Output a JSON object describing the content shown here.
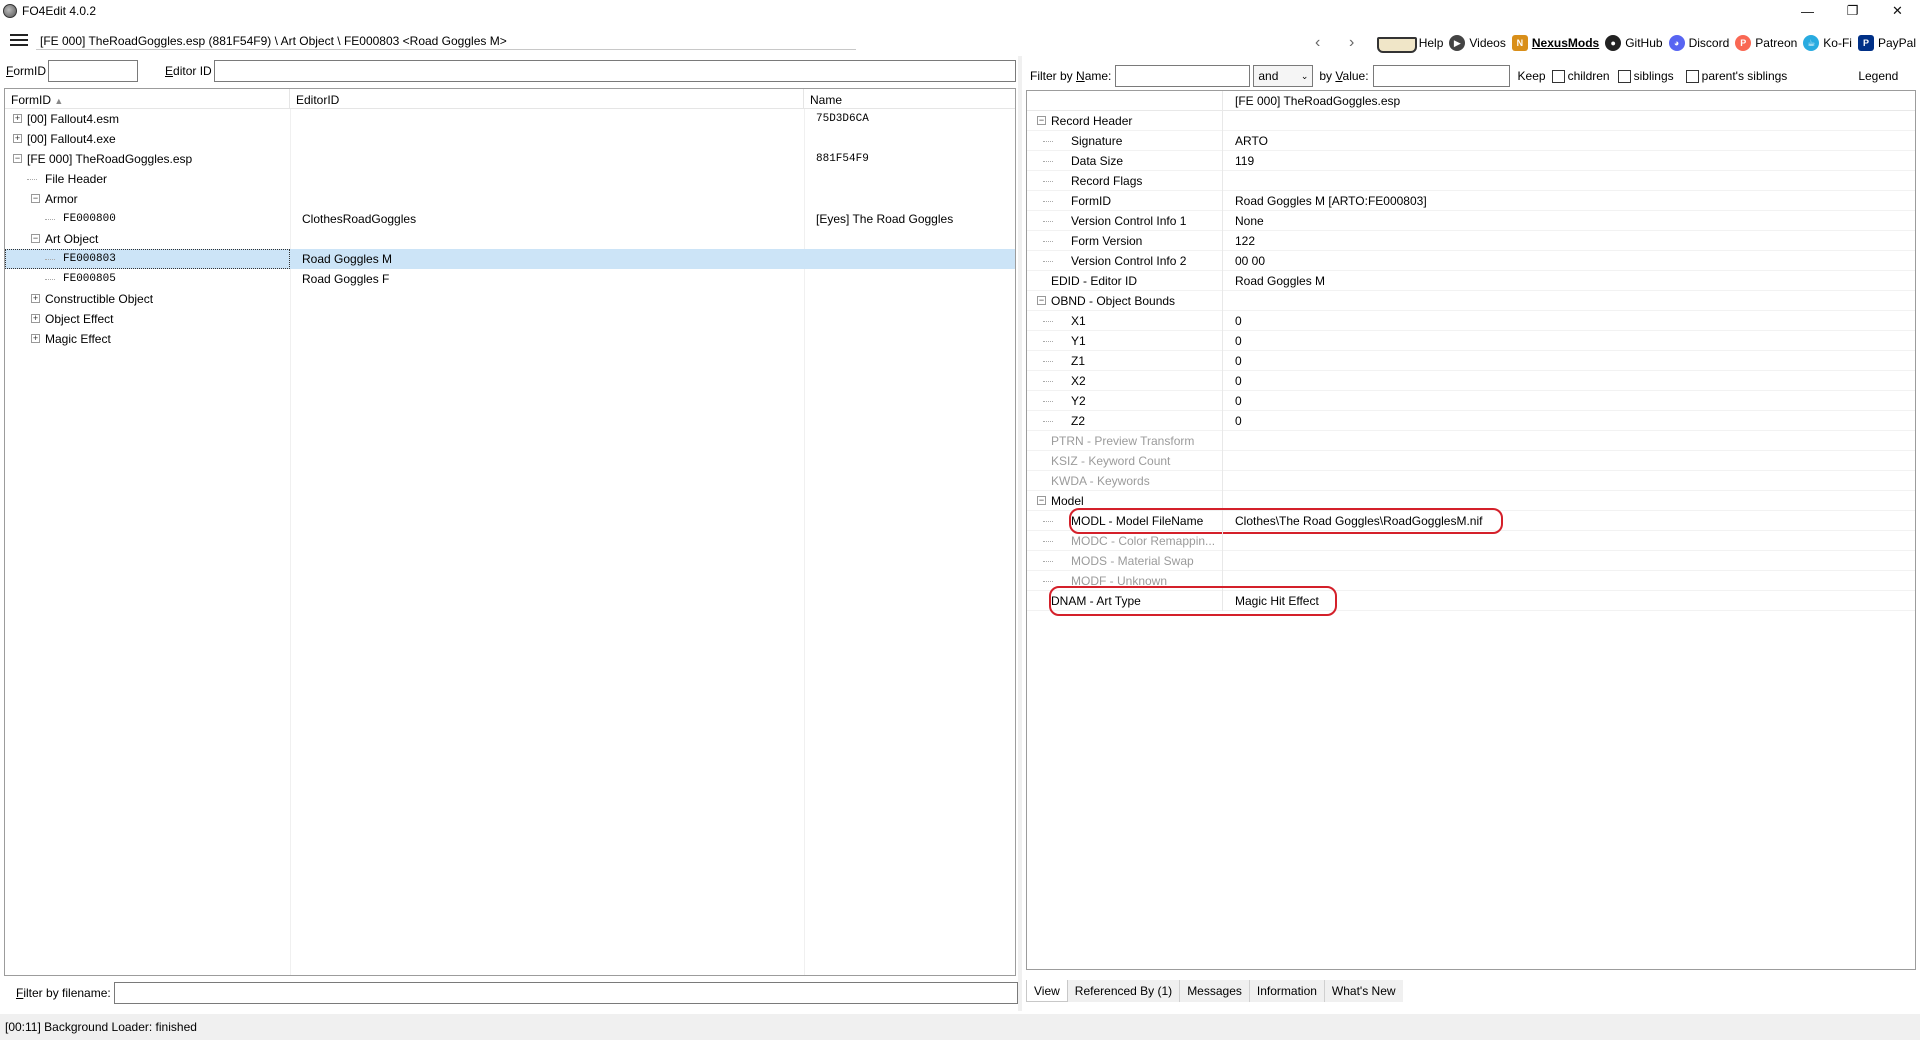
{
  "window": {
    "title": "FO4Edit 4.0.2",
    "controls": [
      "—",
      "❐",
      "✕"
    ]
  },
  "address": {
    "path": "[FE 000] TheRoadGoggles.esp (881F54F9) \\ Art Object \\ FE000803 <Road Goggles M>"
  },
  "toolbar": {
    "back": "‹",
    "forward": "›",
    "items": [
      {
        "label": "Help",
        "icon": "book-icon"
      },
      {
        "label": "Videos",
        "icon": "video-icon",
        "color": "#444444"
      },
      {
        "label": "NexusMods",
        "icon": "nexus-icon",
        "color": "#d98f1a"
      },
      {
        "label": "GitHub",
        "icon": "github-icon",
        "color": "#222222"
      },
      {
        "label": "Discord",
        "icon": "discord-icon",
        "color": "#5865f2"
      },
      {
        "label": "Patreon",
        "icon": "patreon-icon",
        "color": "#f96854"
      },
      {
        "label": "Ko-Fi",
        "icon": "kofi-icon",
        "color": "#29abe0"
      },
      {
        "label": "PayPal",
        "icon": "paypal-icon",
        "color": "#003087"
      }
    ]
  },
  "left_filter": {
    "formid_label_u": "F",
    "formid_label_rest": "ormID",
    "editorid_label_u": "E",
    "editorid_label_rest": "ditor ID",
    "formid_value": "",
    "editorid_value": ""
  },
  "tree": {
    "columns": [
      "FormID",
      "EditorID",
      "Name"
    ],
    "sort_arrow": "▲",
    "rows": [
      {
        "label": "[00] Fallout4.esm",
        "editor": "",
        "name": "75D3D6CA",
        "level": 0,
        "expander": "+",
        "mono_name": true
      },
      {
        "label": "[00] Fallout4.exe",
        "editor": "",
        "name": "",
        "level": 0,
        "expander": "+"
      },
      {
        "label": "[FE 000] TheRoadGoggles.esp",
        "editor": "",
        "name": "881F54F9",
        "level": 0,
        "expander": "−",
        "mono_name": true
      },
      {
        "label": "File Header",
        "editor": "",
        "name": "",
        "level": 1,
        "expander": ""
      },
      {
        "label": "Armor",
        "editor": "",
        "name": "",
        "level": 1,
        "expander": "−"
      },
      {
        "label": "FE000800",
        "editor": "ClothesRoadGoggles",
        "name": "[Eyes] The Road Goggles",
        "level": 2,
        "expander": "",
        "mono_label": true
      },
      {
        "label": "Art Object",
        "editor": "",
        "name": "",
        "level": 1,
        "expander": "−"
      },
      {
        "label": "FE000803",
        "editor": "Road Goggles M",
        "name": "",
        "level": 2,
        "expander": "",
        "mono_label": true,
        "selected": true
      },
      {
        "label": "FE000805",
        "editor": "Road Goggles F",
        "name": "",
        "level": 2,
        "expander": "",
        "mono_label": true
      },
      {
        "label": "Constructible Object",
        "editor": "",
        "name": "",
        "level": 1,
        "expander": "+"
      },
      {
        "label": "Object Effect",
        "editor": "",
        "name": "",
        "level": 1,
        "expander": "+"
      },
      {
        "label": "Magic Effect",
        "editor": "",
        "name": "",
        "level": 1,
        "expander": "+"
      }
    ]
  },
  "left_bottom": {
    "filter_label_u": "F",
    "filter_label_rest": "ilter by filename:",
    "filter_value": ""
  },
  "right_filter": {
    "by_name_label": "Filter by ",
    "by_name_u": "N",
    "by_name_rest": "ame:",
    "by_name_value": "",
    "conjunction": "and",
    "by_value_label": "by ",
    "by_value_u": "V",
    "by_value_rest": "alue:",
    "by_value_value": "",
    "keep_label": "Keep",
    "children": "children",
    "siblings": "siblings",
    "parents_siblings": "parent's siblings",
    "legend": "Legend"
  },
  "grid": {
    "header_value": "[FE 000] TheRoadGoggles.esp",
    "rows": [
      {
        "name": "Record Header",
        "value": "",
        "level": 0,
        "expander": "−"
      },
      {
        "name": "Signature",
        "value": "ARTO",
        "level": 1
      },
      {
        "name": "Data Size",
        "value": "119",
        "level": 1
      },
      {
        "name": "Record Flags",
        "value": "",
        "level": 1
      },
      {
        "name": "FormID",
        "value": "Road Goggles M [ARTO:FE000803]",
        "level": 1
      },
      {
        "name": "Version Control Info 1",
        "value": "None",
        "level": 1
      },
      {
        "name": "Form Version",
        "value": "122",
        "level": 1
      },
      {
        "name": "Version Control Info 2",
        "value": "00 00",
        "level": 1
      },
      {
        "name": "EDID - Editor ID",
        "value": "Road Goggles M",
        "level": 0
      },
      {
        "name": "OBND - Object Bounds",
        "value": "",
        "level": 0,
        "expander": "−"
      },
      {
        "name": "X1",
        "value": "0",
        "level": 1
      },
      {
        "name": "Y1",
        "value": "0",
        "level": 1
      },
      {
        "name": "Z1",
        "value": "0",
        "level": 1
      },
      {
        "name": "X2",
        "value": "0",
        "level": 1
      },
      {
        "name": "Y2",
        "value": "0",
        "level": 1
      },
      {
        "name": "Z2",
        "value": "0",
        "level": 1
      },
      {
        "name": "PTRN - Preview Transform",
        "value": "",
        "level": 0,
        "grey": true
      },
      {
        "name": "KSIZ - Keyword Count",
        "value": "",
        "level": 0,
        "grey": true
      },
      {
        "name": "KWDA - Keywords",
        "value": "",
        "level": 0,
        "grey": true
      },
      {
        "name": "Model",
        "value": "",
        "level": 0,
        "expander": "−"
      },
      {
        "name": "MODL - Model FileName",
        "value": "Clothes\\The Road Goggles\\RoadGogglesM.nif",
        "level": 1,
        "highlight": true
      },
      {
        "name": "MODC - Color Remappin...",
        "value": "",
        "level": 1,
        "grey": true
      },
      {
        "name": "MODS - Material Swap",
        "value": "",
        "level": 1,
        "grey": true
      },
      {
        "name": "MODF - Unknown",
        "value": "",
        "level": 1,
        "grey": true
      },
      {
        "name": "DNAM - Art Type",
        "value": "Magic Hit Effect",
        "level": 0,
        "highlight": true
      }
    ]
  },
  "tabs": [
    "View",
    "Referenced By (1)",
    "Messages",
    "Information",
    "What's New"
  ],
  "status": "[00:11] Background Loader: finished",
  "colors": {
    "selection": "#cce4f7",
    "highlight": "#d4202a"
  }
}
